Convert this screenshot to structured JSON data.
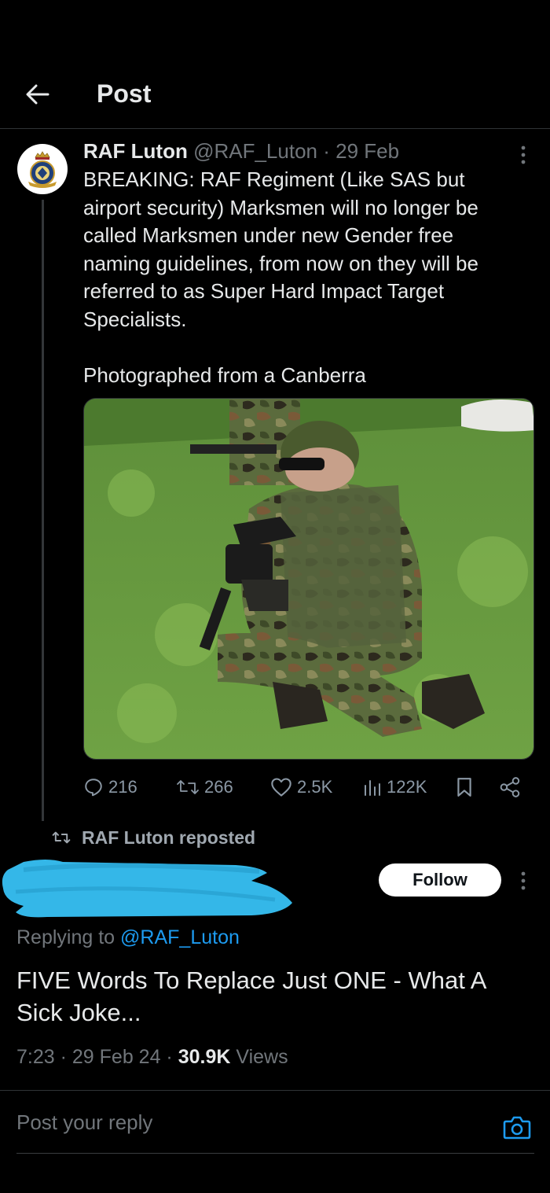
{
  "header": {
    "title": "Post"
  },
  "quoted_tweet": {
    "author_name": "RAF Luton",
    "author_handle": "@RAF_Luton",
    "date": " · 29 Feb",
    "text_main": "BREAKING: RAF Regiment (Like SAS but\nairport security) Marksmen will no longer be\ncalled Marksmen under new Gender free\nnaming guidelines, from now on they will be\nreferred to as Super Hard Impact Target\nSpecialists.",
    "text_second": "Photographed from a Canberra",
    "stats": {
      "replies": "216",
      "reposts": "266",
      "likes": "2.5K",
      "views": "122K"
    }
  },
  "repost_banner": {
    "text": "RAF Luton reposted"
  },
  "main_tweet": {
    "follow_label": "Follow",
    "replying_prefix": "Replying to ",
    "replying_handle": "@RAF_Luton",
    "text": "FIVE Words To Replace Just ONE - What A Sick Joke...",
    "time": "7:23",
    "date": " · 29 Feb 24 · ",
    "views_count": "30.9K",
    "views_label": " Views"
  },
  "reply_box": {
    "placeholder": "Post your reply"
  },
  "colors": {
    "background": "#000000",
    "text": "#e7e9ea",
    "muted": "#71767b",
    "accent": "#1d9bf0",
    "border": "#2f3336",
    "redaction": "#34b7e8"
  }
}
